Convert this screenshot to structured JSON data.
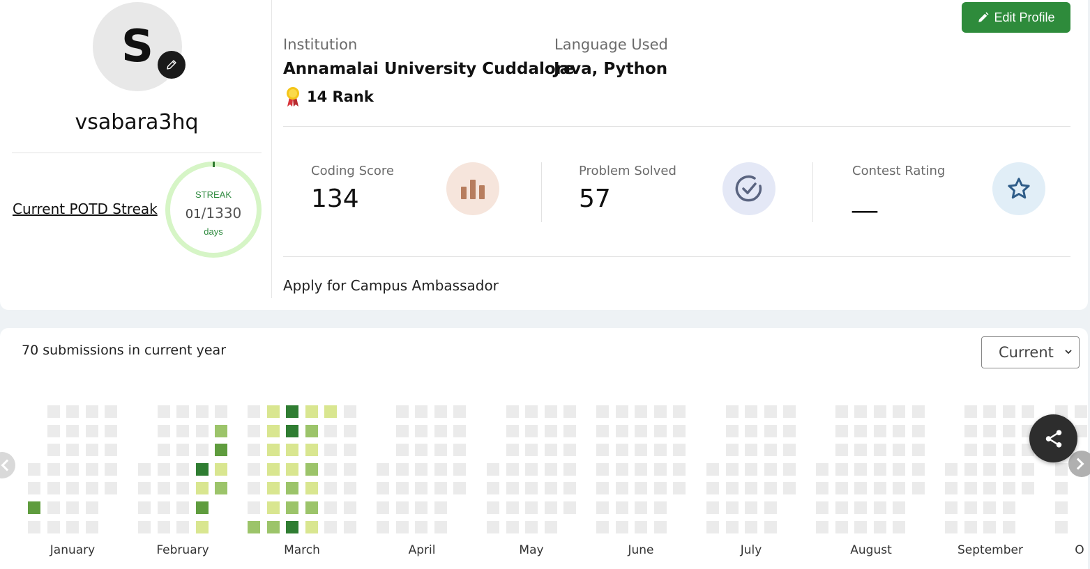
{
  "profile": {
    "avatar_initial": "S",
    "username": "vsabara3hq",
    "edit_profile_label": "Edit Profile",
    "edit_icon": "pencil-icon",
    "avatar_edit_icon": "pencil-icon"
  },
  "streak": {
    "link_label": "Current POTD Streak",
    "label": "STREAK",
    "current": "01",
    "separator": "/",
    "total": "1330",
    "unit": "days"
  },
  "info": {
    "institution_label": "Institution",
    "institution_value": "Annamalai University Cuddalore",
    "language_label": "Language Used",
    "language_value": "Java, Python",
    "rank_text": "14 Rank",
    "rank_icon": "medal-icon"
  },
  "stats": [
    {
      "label": "Coding Score",
      "value": "134",
      "icon": "bar-chart-icon"
    },
    {
      "label": "Problem Solved",
      "value": "57",
      "icon": "check-circle-icon"
    },
    {
      "label": "Contest Rating",
      "value": "__",
      "icon": "star-icon"
    }
  ],
  "ambassador_link": "Apply for Campus Ambassador",
  "submissions": {
    "summary": "70 submissions in current year",
    "year_select": "Current"
  },
  "colors": {
    "brand_green": "#2e8b3b",
    "empty_cell": "#ebebeb",
    "level1": "#d9e690",
    "level2": "#9cc46a",
    "level3": "#5f9c3e",
    "level4": "#2f7d32",
    "streak_ring": "#d6f5c6"
  },
  "heatmap": {
    "months": [
      "January",
      "February",
      "March",
      "April",
      "May",
      "June",
      "July",
      "August",
      "September",
      "October"
    ],
    "month_label_partial": "O"
  },
  "share_icon": "share-icon"
}
